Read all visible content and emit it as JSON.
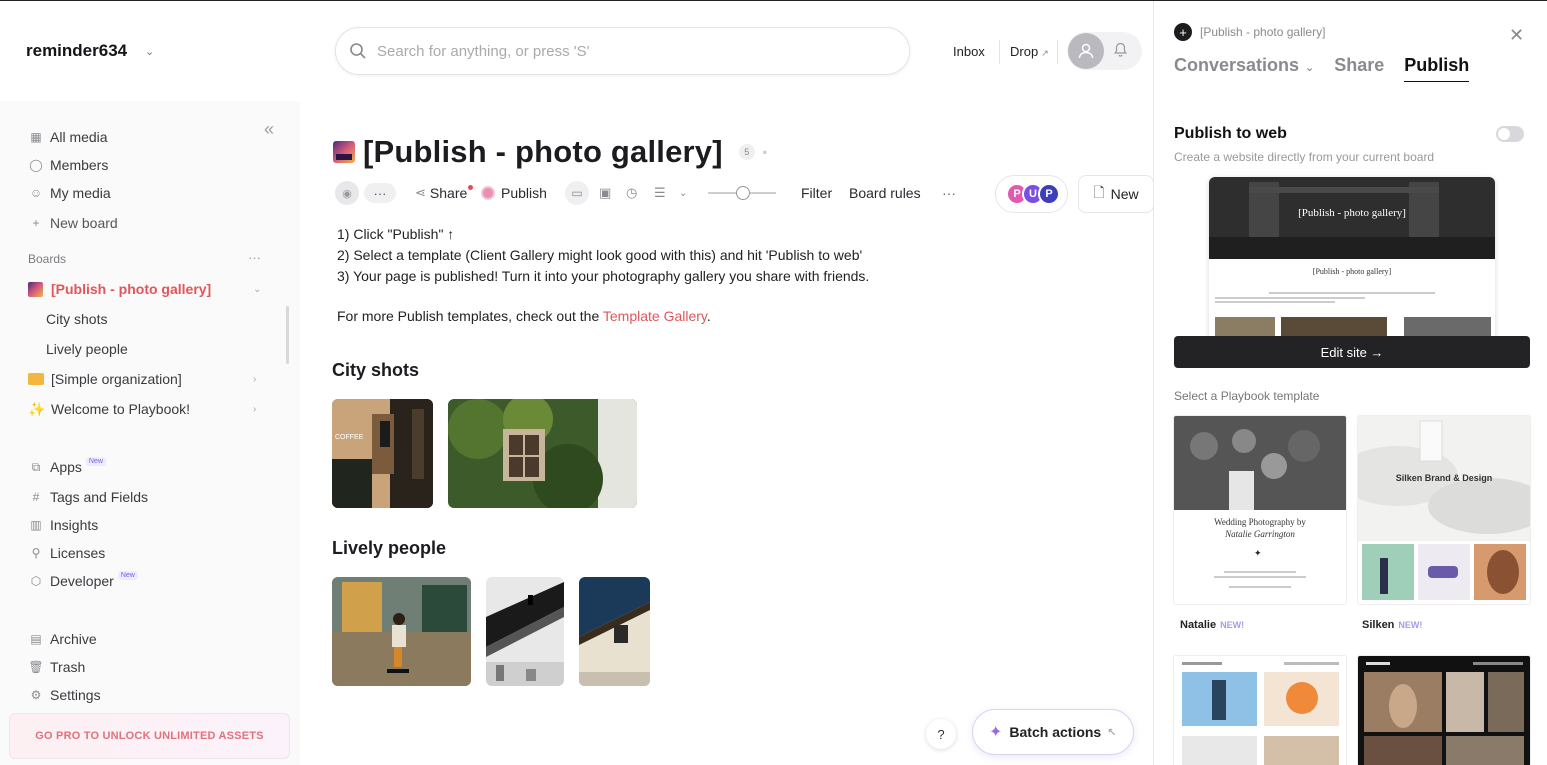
{
  "workspace": {
    "name": "reminder634"
  },
  "search": {
    "placeholder": "Search for anything, or press 'S'"
  },
  "topnav": {
    "inbox": "Inbox",
    "drop": "Drop"
  },
  "sidebar": {
    "nav": [
      {
        "label": "All media"
      },
      {
        "label": "Members"
      },
      {
        "label": "My media"
      },
      {
        "label": "New board"
      }
    ],
    "boards_label": "Boards",
    "boards": [
      {
        "label": "[Publish - photo gallery]"
      },
      {
        "label": "City shots"
      },
      {
        "label": "Lively people"
      },
      {
        "label": "[Simple organization]"
      },
      {
        "label": "Welcome to Playbook!"
      }
    ],
    "tools": [
      {
        "label": "Apps",
        "badge": "New"
      },
      {
        "label": "Tags and Fields"
      },
      {
        "label": "Insights"
      },
      {
        "label": "Licenses"
      },
      {
        "label": "Developer",
        "badge": "New"
      }
    ],
    "bottom": [
      {
        "label": "Archive"
      },
      {
        "label": "Trash"
      },
      {
        "label": "Settings"
      }
    ],
    "gopro": "GO PRO TO UNLOCK UNLIMITED ASSETS"
  },
  "main": {
    "title": "[Publish - photo gallery]",
    "count": "5",
    "toolbar": {
      "share": "Share",
      "publish": "Publish",
      "filter": "Filter",
      "board_rules": "Board rules",
      "new": "New"
    },
    "instructions": [
      "1) Click \"Publish\" ↑",
      "2) Select a template (Client Gallery might look good with this) and hit 'Publish to web'",
      "3) Your page is published! Turn it into your photography gallery you share with friends."
    ],
    "more_prefix": "For more Publish templates, check out the ",
    "more_link": "Template Gallery",
    "more_suffix": ".",
    "sections": [
      {
        "title": "City shots"
      },
      {
        "title": "Lively people"
      }
    ],
    "help": "?",
    "batch": "Batch actions"
  },
  "panel": {
    "crumb": "[Publish - photo gallery]",
    "tabs": [
      {
        "label": "Conversations"
      },
      {
        "label": "Share"
      },
      {
        "label": "Publish"
      }
    ],
    "publish_to_web": "Publish to web",
    "publish_sub": "Create a website directly from your current board",
    "preview_title": "[Publish - photo gallery]",
    "edit_site": "Edit site →",
    "select_template": "Select a Playbook template",
    "templates": [
      {
        "name": "Natalie",
        "badge": "NEW!",
        "heading": "Wedding Photography by",
        "heading2": "Natalie Garrington"
      },
      {
        "name": "Silken",
        "badge": "NEW!",
        "heading": "Silken Brand & Design"
      }
    ]
  },
  "colors": {
    "accent": "#e0565b",
    "dark_button": "#232326",
    "batch_spark": "#9b6ae0"
  }
}
